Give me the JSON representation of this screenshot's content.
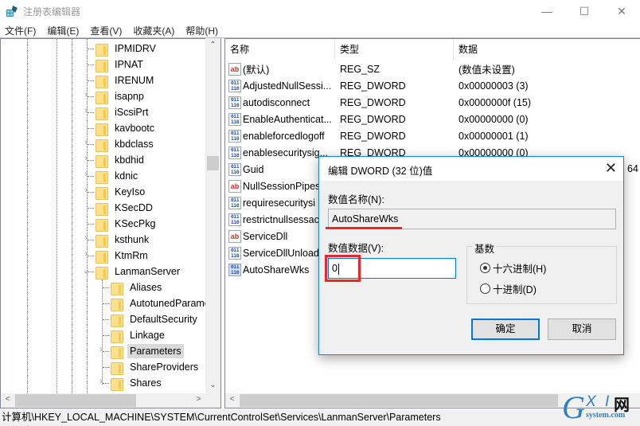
{
  "window": {
    "title": "注册表编辑器",
    "app_icon": "regedit-icon",
    "controls": {
      "minimize": "—",
      "maximize": "☐",
      "close": "✕"
    }
  },
  "menubar": {
    "items": [
      "文件(F)",
      "编辑(E)",
      "查看(V)",
      "收藏夹(A)",
      "帮助(H)"
    ]
  },
  "tree": {
    "items": [
      {
        "label": "IPMIDRV",
        "expandable": false
      },
      {
        "label": "IPNAT",
        "expandable": false
      },
      {
        "label": "IRENUM",
        "expandable": false
      },
      {
        "label": "isapnp",
        "expandable": true
      },
      {
        "label": "iScsiPrt",
        "expandable": true
      },
      {
        "label": "kavbootc",
        "expandable": false
      },
      {
        "label": "kbdclass",
        "expandable": true
      },
      {
        "label": "kbdhid",
        "expandable": true
      },
      {
        "label": "kdnic",
        "expandable": true
      },
      {
        "label": "KeyIso",
        "expandable": true
      },
      {
        "label": "KSecDD",
        "expandable": false
      },
      {
        "label": "KSecPkg",
        "expandable": false
      },
      {
        "label": "ksthunk",
        "expandable": true
      },
      {
        "label": "KtmRm",
        "expandable": true
      },
      {
        "label": "LanmanServer",
        "expandable": true,
        "expanded": true
      },
      {
        "label": "Aliases",
        "expandable": false,
        "child": true
      },
      {
        "label": "AutotunedParame",
        "expandable": false,
        "child": true
      },
      {
        "label": "DefaultSecurity",
        "expandable": false,
        "child": true
      },
      {
        "label": "Linkage",
        "expandable": false,
        "child": true
      },
      {
        "label": "Parameters",
        "expandable": true,
        "child": true,
        "selected": true
      },
      {
        "label": "ShareProviders",
        "expandable": false,
        "child": true
      },
      {
        "label": "Shares",
        "expandable": true,
        "child": true
      }
    ]
  },
  "list": {
    "columns": [
      "名称",
      "类型",
      "数据"
    ],
    "rows": [
      {
        "icon": "string-value-icon",
        "name": "(默认)",
        "type": "REG_SZ",
        "data": "(数值未设置)"
      },
      {
        "icon": "binary-value-icon",
        "name": "AdjustedNullSessi...",
        "type": "REG_DWORD",
        "data": "0x00000003 (3)"
      },
      {
        "icon": "binary-value-icon",
        "name": "autodisconnect",
        "type": "REG_DWORD",
        "data": "0x0000000f (15)"
      },
      {
        "icon": "binary-value-icon",
        "name": "EnableAuthenticat...",
        "type": "REG_DWORD",
        "data": "0x00000000 (0)"
      },
      {
        "icon": "binary-value-icon",
        "name": "enableforcedlogoff",
        "type": "REG_DWORD",
        "data": "0x00000001 (1)"
      },
      {
        "icon": "binary-value-icon",
        "name": "enablesecuritysig...",
        "type": "REG_DWORD",
        "data": "0x00000000 (0)"
      },
      {
        "icon": "binary-value-icon",
        "name": "Guid",
        "type": "",
        "data": ""
      },
      {
        "icon": "string-value-icon",
        "name": "NullSessionPipes",
        "type": "",
        "data": ""
      },
      {
        "icon": "binary-value-icon",
        "name": "requiresecuritysi",
        "type": "",
        "data": ""
      },
      {
        "icon": "binary-value-icon",
        "name": "restrictnullsessac",
        "type": "",
        "data": ""
      },
      {
        "icon": "string-value-icon",
        "name": "ServiceDll",
        "type": "",
        "data": ""
      },
      {
        "icon": "binary-value-icon",
        "name": "ServiceDllUnload",
        "type": "",
        "data": ""
      },
      {
        "icon": "binary-value-icon",
        "name": "AutoShareWks",
        "type": "",
        "data": "",
        "highlight": true
      }
    ],
    "peek_text": "64"
  },
  "dialog": {
    "title": "编辑 DWORD (32 位)值",
    "name_label": "数值名称(N):",
    "name_value": "AutoShareWks",
    "data_label": "数值数据(V):",
    "data_value": "0",
    "base_group_label": "基数",
    "base_options": [
      {
        "label": "十六进制(H)",
        "checked": true
      },
      {
        "label": "十进制(D)",
        "checked": false
      }
    ],
    "ok_label": "确定",
    "cancel_label": "取消",
    "annotation_color": "#e8262b"
  },
  "statusbar": {
    "path": "计算机\\HKEY_LOCAL_MACHINE\\SYSTEM\\CurrentControlSet\\Services\\LanmanServer\\Parameters"
  },
  "watermark": {
    "g": "G",
    "xi": "X I",
    "wang": "网",
    "domain": "system.com"
  }
}
